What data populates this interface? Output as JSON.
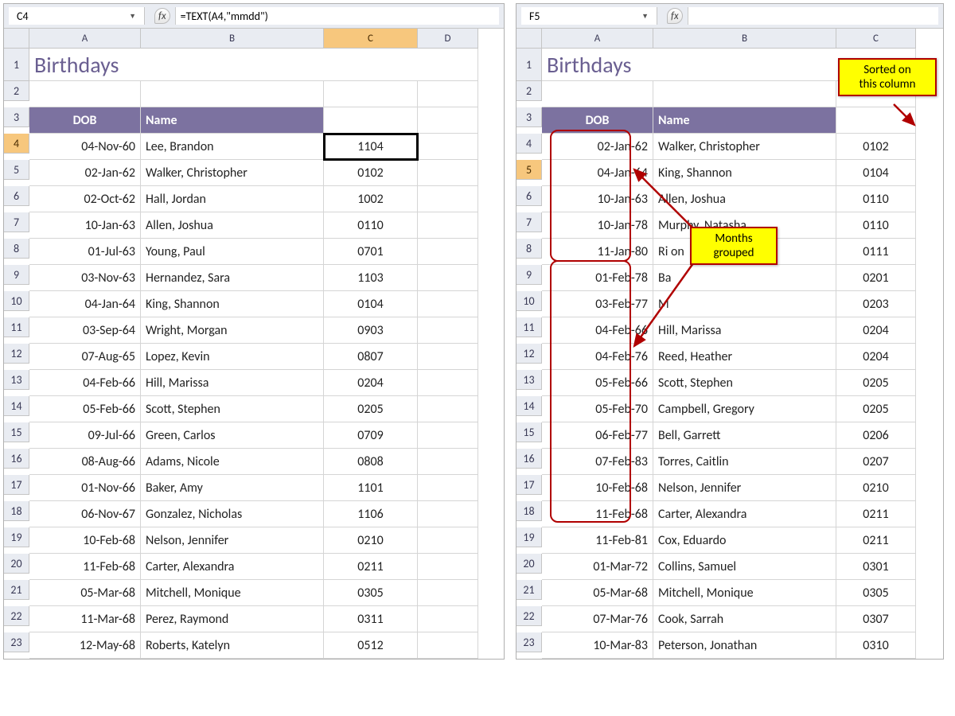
{
  "left": {
    "nameBox": "C4",
    "formula": "=TEXT(A4,\"mmdd\")",
    "title": "Birthdays",
    "cols": [
      "A",
      "B",
      "C",
      "D"
    ],
    "headers": {
      "dob": "DOB",
      "name": "Name"
    },
    "rows": [
      {
        "n": "4",
        "dob": "04-Nov-60",
        "name": "Lee, Brandon",
        "c": "1104",
        "active": true
      },
      {
        "n": "5",
        "dob": "02-Jan-62",
        "name": "Walker, Christopher",
        "c": "0102"
      },
      {
        "n": "6",
        "dob": "02-Oct-62",
        "name": "Hall, Jordan",
        "c": "1002"
      },
      {
        "n": "7",
        "dob": "10-Jan-63",
        "name": "Allen, Joshua",
        "c": "0110"
      },
      {
        "n": "8",
        "dob": "01-Jul-63",
        "name": "Young, Paul",
        "c": "0701"
      },
      {
        "n": "9",
        "dob": "03-Nov-63",
        "name": "Hernandez, Sara",
        "c": "1103"
      },
      {
        "n": "10",
        "dob": "04-Jan-64",
        "name": "King, Shannon",
        "c": "0104"
      },
      {
        "n": "11",
        "dob": "03-Sep-64",
        "name": "Wright, Morgan",
        "c": "0903"
      },
      {
        "n": "12",
        "dob": "07-Aug-65",
        "name": "Lopez, Kevin",
        "c": "0807"
      },
      {
        "n": "13",
        "dob": "04-Feb-66",
        "name": "Hill, Marissa",
        "c": "0204"
      },
      {
        "n": "14",
        "dob": "05-Feb-66",
        "name": "Scott, Stephen",
        "c": "0205"
      },
      {
        "n": "15",
        "dob": "09-Jul-66",
        "name": "Green, Carlos",
        "c": "0709"
      },
      {
        "n": "16",
        "dob": "08-Aug-66",
        "name": "Adams, Nicole",
        "c": "0808"
      },
      {
        "n": "17",
        "dob": "01-Nov-66",
        "name": "Baker, Amy",
        "c": "1101"
      },
      {
        "n": "18",
        "dob": "06-Nov-67",
        "name": "Gonzalez, Nicholas",
        "c": "1106"
      },
      {
        "n": "19",
        "dob": "10-Feb-68",
        "name": "Nelson, Jennifer",
        "c": "0210"
      },
      {
        "n": "20",
        "dob": "11-Feb-68",
        "name": "Carter, Alexandra",
        "c": "0211"
      },
      {
        "n": "21",
        "dob": "05-Mar-68",
        "name": "Mitchell, Monique",
        "c": "0305"
      },
      {
        "n": "22",
        "dob": "11-Mar-68",
        "name": "Perez, Raymond",
        "c": "0311"
      },
      {
        "n": "23",
        "dob": "12-May-68",
        "name": "Roberts, Katelyn",
        "c": "0512"
      }
    ]
  },
  "right": {
    "nameBox": "F5",
    "formula": "",
    "title": "Birthdays",
    "cols": [
      "A",
      "B",
      "C"
    ],
    "headers": {
      "dob": "DOB",
      "name": "Name"
    },
    "callouts": {
      "sorted": "Sorted on\nthis column",
      "grouped": "Months\ngrouped"
    },
    "rows": [
      {
        "n": "4",
        "dob": "02-Jan-62",
        "name": "Walker, Christopher",
        "c": "0102"
      },
      {
        "n": "5",
        "dob": "04-Jan-64",
        "name": "King, Shannon",
        "c": "0104",
        "active": true
      },
      {
        "n": "6",
        "dob": "10-Jan-63",
        "name": "Allen, Joshua",
        "c": "0110"
      },
      {
        "n": "7",
        "dob": "10-Jan-78",
        "name": "Murphy, Natasha",
        "c": "0110"
      },
      {
        "n": "8",
        "dob": "11-Jan-80",
        "name": "Ri                on",
        "c": "0111"
      },
      {
        "n": "9",
        "dob": "01-Feb-78",
        "name": "Ba",
        "c": "0201"
      },
      {
        "n": "10",
        "dob": "03-Feb-77",
        "name": "M",
        "c": "0203"
      },
      {
        "n": "11",
        "dob": "04-Feb-66",
        "name": "Hill, Marissa",
        "c": "0204"
      },
      {
        "n": "12",
        "dob": "04-Feb-76",
        "name": "Reed, Heather",
        "c": "0204"
      },
      {
        "n": "13",
        "dob": "05-Feb-66",
        "name": "Scott, Stephen",
        "c": "0205"
      },
      {
        "n": "14",
        "dob": "05-Feb-70",
        "name": "Campbell, Gregory",
        "c": "0205"
      },
      {
        "n": "15",
        "dob": "06-Feb-77",
        "name": "Bell, Garrett",
        "c": "0206"
      },
      {
        "n": "16",
        "dob": "07-Feb-83",
        "name": "Torres, Caitlin",
        "c": "0207"
      },
      {
        "n": "17",
        "dob": "10-Feb-68",
        "name": "Nelson, Jennifer",
        "c": "0210"
      },
      {
        "n": "18",
        "dob": "11-Feb-68",
        "name": "Carter, Alexandra",
        "c": "0211"
      },
      {
        "n": "19",
        "dob": "11-Feb-81",
        "name": "Cox, Eduardo",
        "c": "0211"
      },
      {
        "n": "20",
        "dob": "01-Mar-72",
        "name": "Collins, Samuel",
        "c": "0301"
      },
      {
        "n": "21",
        "dob": "05-Mar-68",
        "name": "Mitchell, Monique",
        "c": "0305"
      },
      {
        "n": "22",
        "dob": "07-Mar-76",
        "name": "Cook, Sarrah",
        "c": "0307"
      },
      {
        "n": "23",
        "dob": "10-Mar-83",
        "name": "Peterson, Jonathan",
        "c": "0310"
      }
    ]
  }
}
